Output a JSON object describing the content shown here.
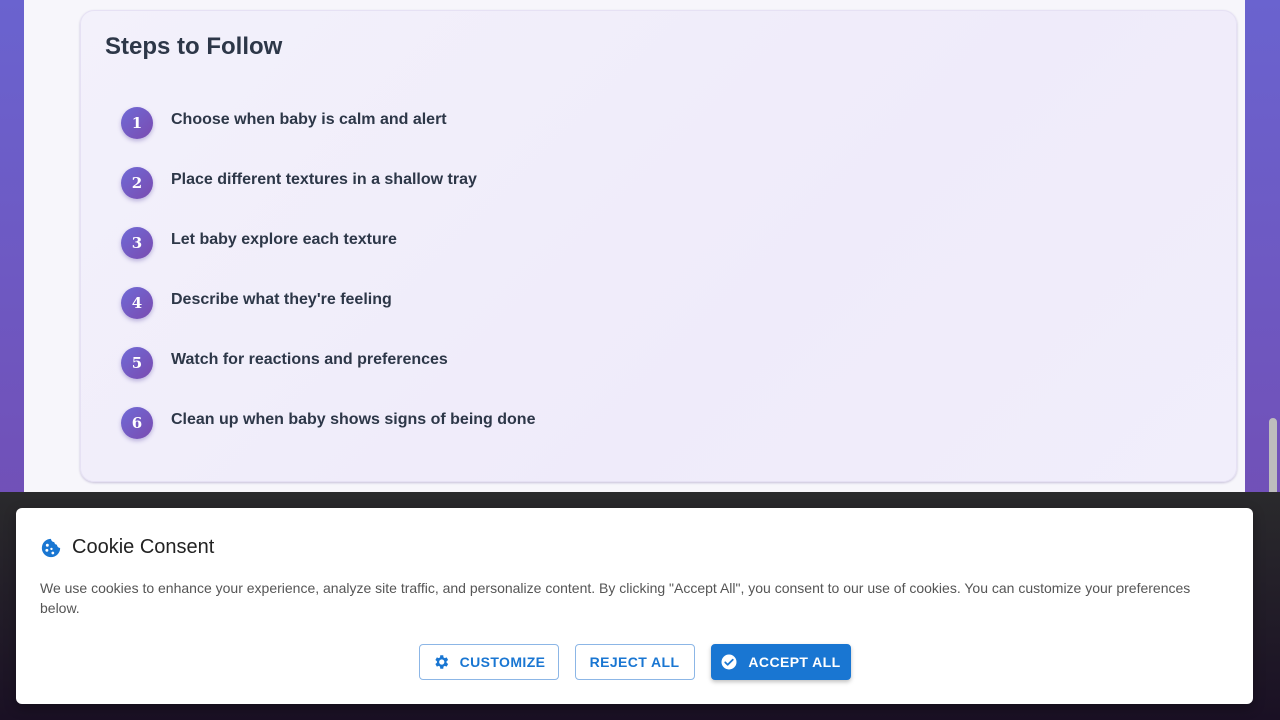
{
  "steps": {
    "title": "Steps to Follow",
    "items": [
      {
        "number": "1",
        "text": "Choose when baby is calm and alert"
      },
      {
        "number": "2",
        "text": "Place different textures in a shallow tray"
      },
      {
        "number": "3",
        "text": "Let baby explore each texture"
      },
      {
        "number": "4",
        "text": "Describe what they're feeling"
      },
      {
        "number": "5",
        "text": "Watch for reactions and preferences"
      },
      {
        "number": "6",
        "text": "Clean up when baby shows signs of being done"
      }
    ]
  },
  "cookie": {
    "icon": "cookie-icon",
    "title": "Cookie Consent",
    "message": "We use cookies to enhance your experience, analyze site traffic, and personalize content. By clicking \"Accept All\", you consent to our use of cookies. You can customize your preferences below.",
    "customize_label": "CUSTOMIZE",
    "reject_label": "REJECT ALL",
    "accept_label": "ACCEPT ALL",
    "accent_color": "#1976d2"
  }
}
